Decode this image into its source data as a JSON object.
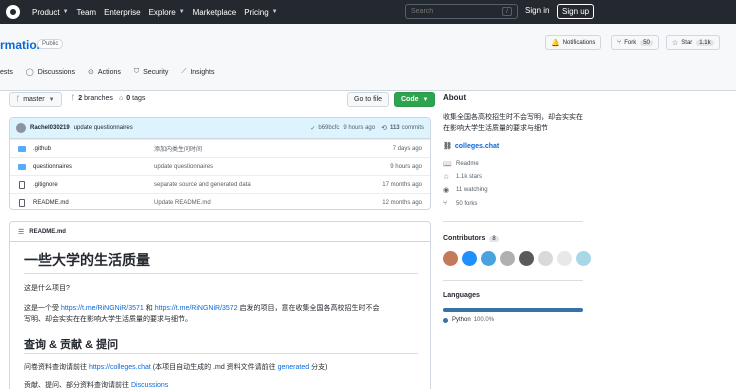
{
  "topbar": {
    "nav": [
      {
        "label": "Product",
        "dropdown": true
      },
      {
        "label": "Team",
        "dropdown": false
      },
      {
        "label": "Enterprise",
        "dropdown": false
      },
      {
        "label": "Explore",
        "dropdown": true
      },
      {
        "label": "Marketplace",
        "dropdown": false
      },
      {
        "label": "Pricing",
        "dropdown": true
      }
    ],
    "search_placeholder": "Search",
    "search_shortcut": "/",
    "sign_in": "Sign in",
    "sign_up": "Sign up"
  },
  "repo": {
    "name": "rmation",
    "visibility": "Public",
    "notifications_label": "Notifications",
    "fork_label": "Fork",
    "fork_count": "50",
    "star_label": "Star",
    "star_count": "1.1k",
    "tabs": [
      {
        "label": "ests",
        "icon": "pull-request-icon"
      },
      {
        "label": "Discussions",
        "icon": "comment-icon"
      },
      {
        "label": "Actions",
        "icon": "play-icon"
      },
      {
        "label": "Security",
        "icon": "shield-icon"
      },
      {
        "label": "Insights",
        "icon": "graph-icon"
      }
    ]
  },
  "toolbar": {
    "branch": "master",
    "branches_count": "2",
    "branches_label": "branches",
    "tags_count": "0",
    "tags_label": "tags",
    "go_to_file": "Go to file",
    "code": "Code"
  },
  "commit": {
    "author": "Rachel030219",
    "message": "update questionnaires",
    "hash": "b69bcfc",
    "time": "9 hours ago",
    "commits_count": "113",
    "commits_label": "commits"
  },
  "files": [
    {
      "name": ".github",
      "type": "dir",
      "message": "添加内类生问时间",
      "date": "7 days ago"
    },
    {
      "name": "questionnaires",
      "type": "dir",
      "message": "update questionnaires",
      "date": "9 hours ago"
    },
    {
      "name": ".gitignore",
      "type": "file",
      "message": "separate source and generated data",
      "date": "17 months ago"
    },
    {
      "name": "README.md",
      "type": "file",
      "message": "Update README.md",
      "date": "12 months ago"
    }
  ],
  "readme": {
    "filename": "README.md",
    "h1": "一些大学的生活质量",
    "q1": "这是什么项目?",
    "p1_before": "这是一个受 ",
    "p1_link1": "https://t.me/RiNGNiR/3571",
    "p1_mid": " 和 ",
    "p1_link2": "https://t.me/RiNGNiR/3572",
    "p1_after": " 启发的项目，意在收集全国各高校招生时不会",
    "p1_line2": "写明、却会实实在在影响大学生活质量的要求与细节。",
    "h2": "查询 & 贡献 & 提问",
    "p2_before": "问卷资料查询请前往 ",
    "p2_link1": "https://colleges.chat",
    "p2_mid": " (本项目自动生成的 .md 资料文件请前往 ",
    "p2_link2": "generated",
    "p2_after": " 分支)",
    "p3_before": "贡献、提问、部分资料查询请前往 ",
    "p3_link": "Discussions"
  },
  "about": {
    "title": "About",
    "description": "收集全国各高校招生时不会写明，却会实实在在影响大学生活质量的要求与细节",
    "website": "colleges.chat",
    "readme": "Readme",
    "stars": "1.1k stars",
    "watching": "11 watching",
    "forks": "50 forks"
  },
  "contributors": {
    "title": "Contributors",
    "count": "8",
    "avatars": [
      {
        "bg": "#c47a5a",
        "icon": "avatar"
      },
      {
        "bg": "#1e90ff",
        "icon": "avatar"
      },
      {
        "bg": "#4aa3df",
        "icon": "avatar"
      },
      {
        "bg": "#b0b0b0",
        "icon": "avatar"
      },
      {
        "bg": "#5a5a5a",
        "icon": "avatar"
      },
      {
        "bg": "#d9d9d9",
        "icon": "avatar"
      },
      {
        "bg": "#e8e8e8",
        "icon": "avatar"
      },
      {
        "bg": "#a8d8e8",
        "icon": "avatar"
      }
    ]
  },
  "languages": {
    "title": "Languages",
    "items": [
      {
        "name": "Python",
        "percent": "100.0%",
        "color": "#3572a5"
      }
    ]
  }
}
